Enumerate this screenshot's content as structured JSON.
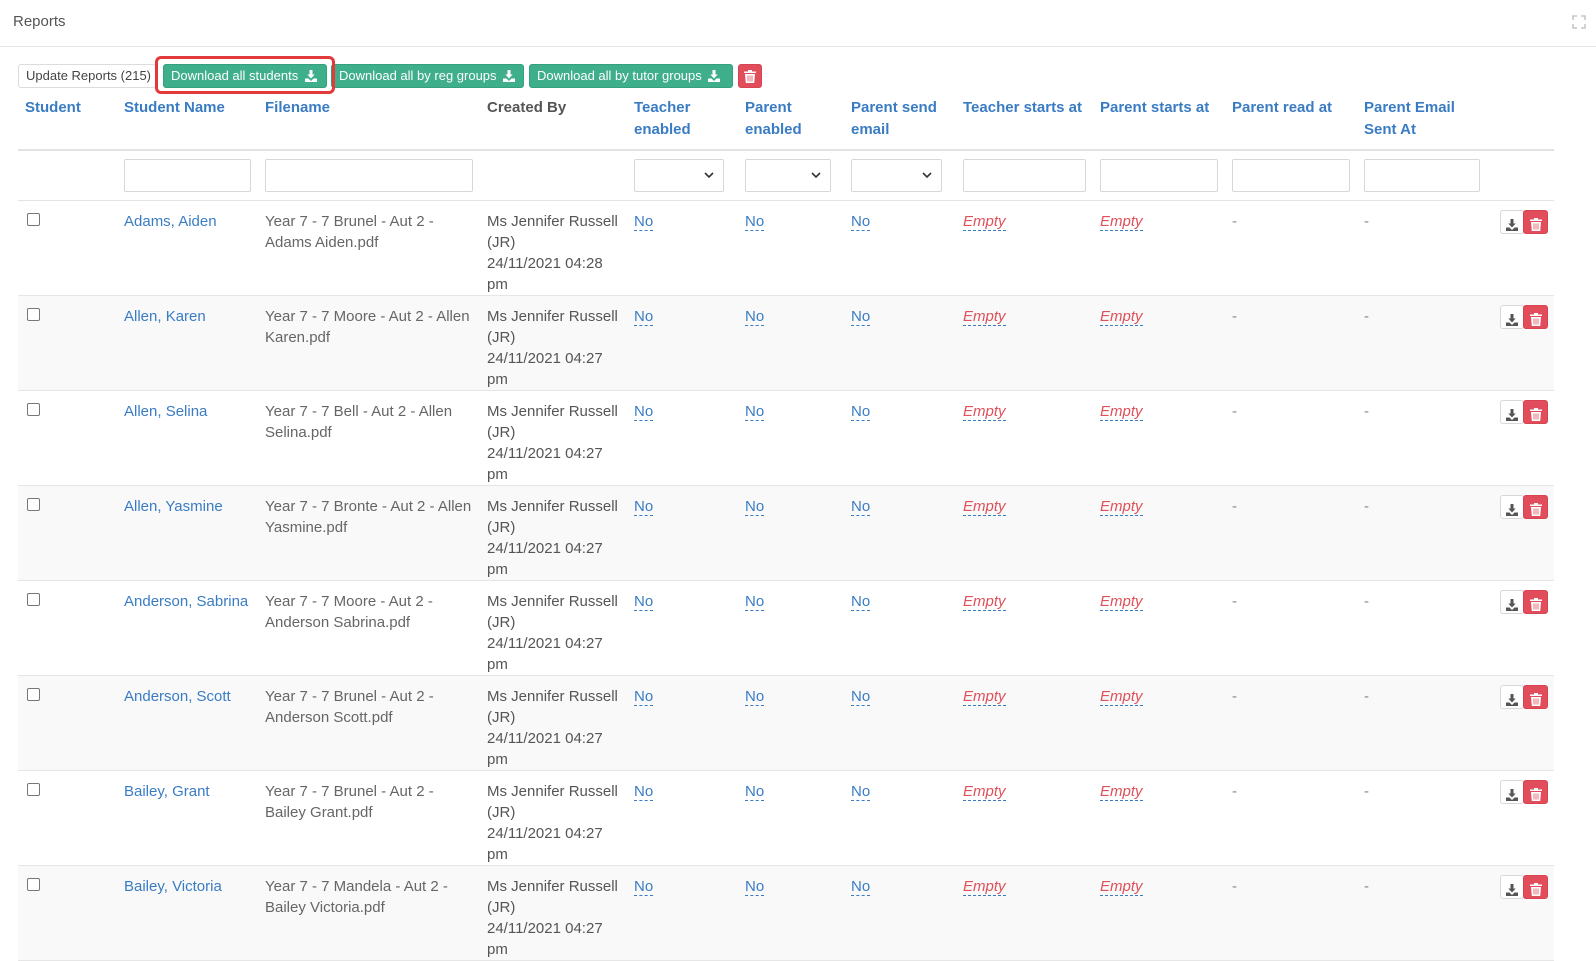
{
  "panel": {
    "title": "Reports"
  },
  "toolbar": {
    "update_label": "Update Reports (215)",
    "download_all_label": "Download all students",
    "download_reg_label": "Download all by reg groups",
    "download_tutor_label": "Download all by tutor groups"
  },
  "table": {
    "headers": [
      "Student",
      "Student Name",
      "Filename",
      "Created By",
      "Teacher enabled",
      "Parent enabled",
      "Parent send email",
      "Teacher starts at",
      "Parent starts at",
      "Parent read at",
      "Parent Email Sent At"
    ],
    "rows": [
      {
        "name": "Adams, Aiden",
        "file": "Year 7 - 7 Brunel - Aut 2 - Adams Aiden.pdf",
        "by": "Ms Jennifer Russell (JR)",
        "date": "24/11/2021 04:28 pm",
        "teacher_enabled": "No",
        "parent_enabled": "No",
        "parent_send_email": "No",
        "teacher_starts": "Empty",
        "parent_starts": "Empty",
        "read_at": "-",
        "sent_at": "-"
      },
      {
        "name": "Allen, Karen",
        "file": "Year 7 - 7 Moore - Aut 2 - Allen Karen.pdf",
        "by": "Ms Jennifer Russell (JR)",
        "date": "24/11/2021 04:27 pm",
        "teacher_enabled": "No",
        "parent_enabled": "No",
        "parent_send_email": "No",
        "teacher_starts": "Empty",
        "parent_starts": "Empty",
        "read_at": "-",
        "sent_at": "-"
      },
      {
        "name": "Allen, Selina",
        "file": "Year 7 - 7 Bell - Aut 2 - Allen Selina.pdf",
        "by": "Ms Jennifer Russell (JR)",
        "date": "24/11/2021 04:27 pm",
        "teacher_enabled": "No",
        "parent_enabled": "No",
        "parent_send_email": "No",
        "teacher_starts": "Empty",
        "parent_starts": "Empty",
        "read_at": "-",
        "sent_at": "-"
      },
      {
        "name": "Allen, Yasmine",
        "file": "Year 7 - 7 Bronte - Aut 2 - Allen Yasmine.pdf",
        "by": "Ms Jennifer Russell (JR)",
        "date": "24/11/2021 04:27 pm",
        "teacher_enabled": "No",
        "parent_enabled": "No",
        "parent_send_email": "No",
        "teacher_starts": "Empty",
        "parent_starts": "Empty",
        "read_at": "-",
        "sent_at": "-"
      },
      {
        "name": "Anderson, Sabrina",
        "file": "Year 7 - 7 Moore - Aut 2 - Anderson Sabrina.pdf",
        "by": "Ms Jennifer Russell (JR)",
        "date": "24/11/2021 04:27 pm",
        "teacher_enabled": "No",
        "parent_enabled": "No",
        "parent_send_email": "No",
        "teacher_starts": "Empty",
        "parent_starts": "Empty",
        "read_at": "-",
        "sent_at": "-"
      },
      {
        "name": "Anderson, Scott",
        "file": "Year 7 - 7 Brunel - Aut 2 - Anderson Scott.pdf",
        "by": "Ms Jennifer Russell (JR)",
        "date": "24/11/2021 04:27 pm",
        "teacher_enabled": "No",
        "parent_enabled": "No",
        "parent_send_email": "No",
        "teacher_starts": "Empty",
        "parent_starts": "Empty",
        "read_at": "-",
        "sent_at": "-"
      },
      {
        "name": "Bailey, Grant",
        "file": "Year 7 - 7 Brunel - Aut 2 - Bailey Grant.pdf",
        "by": "Ms Jennifer Russell (JR)",
        "date": "24/11/2021 04:27 pm",
        "teacher_enabled": "No",
        "parent_enabled": "No",
        "parent_send_email": "No",
        "teacher_starts": "Empty",
        "parent_starts": "Empty",
        "read_at": "-",
        "sent_at": "-"
      },
      {
        "name": "Bailey, Victoria",
        "file": "Year 7 - 7 Mandela - Aut 2 - Bailey Victoria.pdf",
        "by": "Ms Jennifer Russell (JR)",
        "date": "24/11/2021 04:27 pm",
        "teacher_enabled": "No",
        "parent_enabled": "No",
        "parent_send_email": "No",
        "teacher_starts": "Empty",
        "parent_starts": "Empty",
        "read_at": "-",
        "sent_at": "-"
      }
    ]
  },
  "colors": {
    "accent_blue": "#3a7cc4",
    "green": "#3fae8a",
    "red": "#e14d5a",
    "highlight": "#e23a3a"
  },
  "icons": {
    "download": "download-icon",
    "delete": "trash-icon",
    "expand": "expand-icon",
    "select": "chevron-down-icon"
  }
}
